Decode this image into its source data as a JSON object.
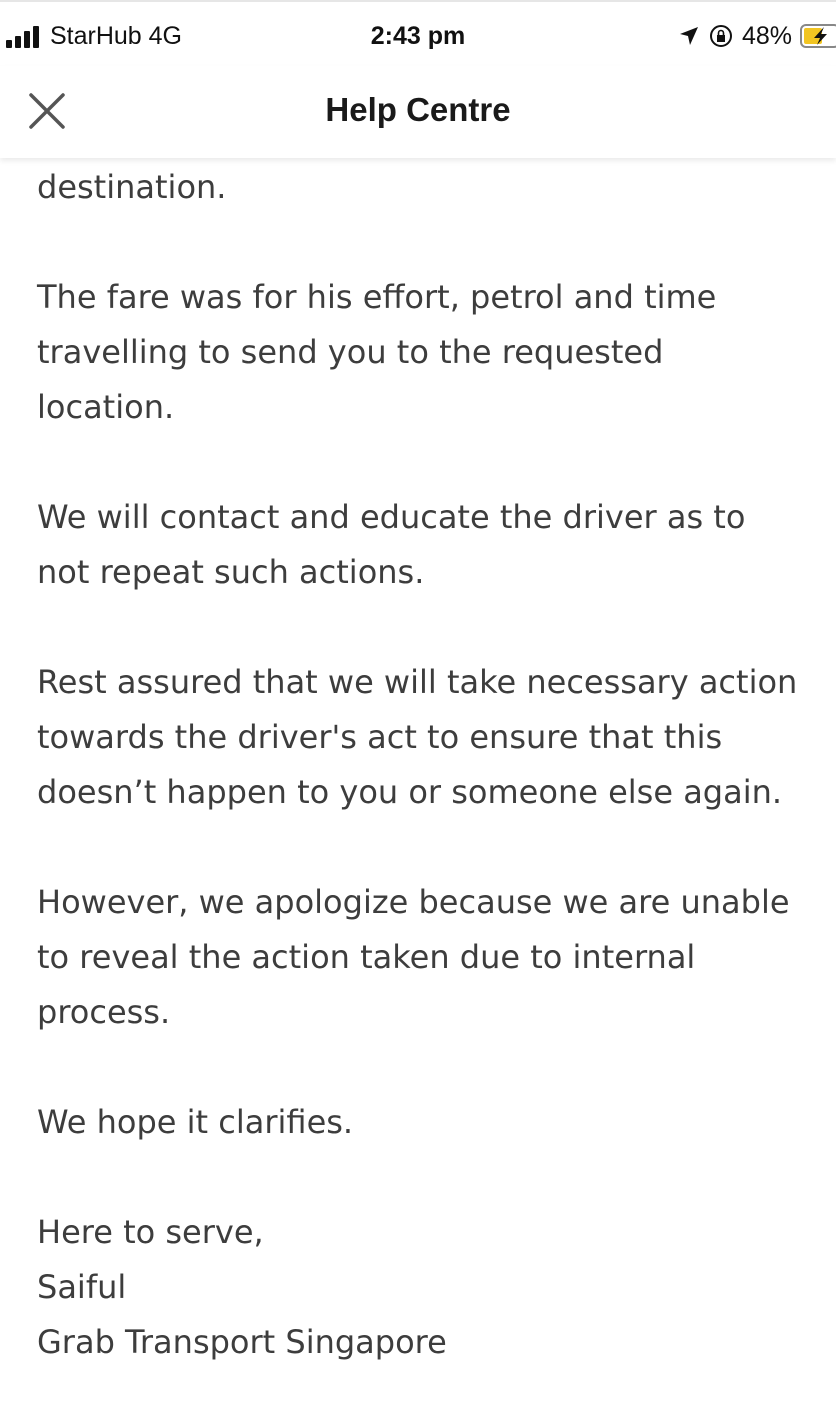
{
  "status_bar": {
    "carrier": "StarHub  4G",
    "time": "2:43 pm",
    "battery_percent": "48%",
    "icons": [
      "signal-bars-icon",
      "location-arrow-icon",
      "rotation-lock-icon",
      "battery-charging-icon"
    ]
  },
  "header": {
    "title": "Help Centre",
    "close_icon": "close-icon"
  },
  "message": {
    "p0": "destination.",
    "p1": [
      "The fare was for his effort, petrol and time",
      "travelling to send you to the requested",
      "location."
    ],
    "p2": [
      "We will contact and educate the driver as to",
      "not repeat such actions."
    ],
    "p3": [
      "Rest assured that we will take necessary action",
      "towards the driver's act to ensure that this",
      "doesn’t happen to you or someone else again."
    ],
    "p4": [
      "However, we apologize because we are unable",
      "to reveal the action taken due to internal",
      "process."
    ],
    "p5": "We hope it clarifies.",
    "signoff": "Here to serve,",
    "signer_name": "Saiful",
    "signer_org": "Grab Transport Singapore"
  },
  "colors": {
    "text": "#3d3d3d",
    "title": "#1a1a1a",
    "battery_accent": "#f2c522",
    "background": "#ffffff"
  }
}
